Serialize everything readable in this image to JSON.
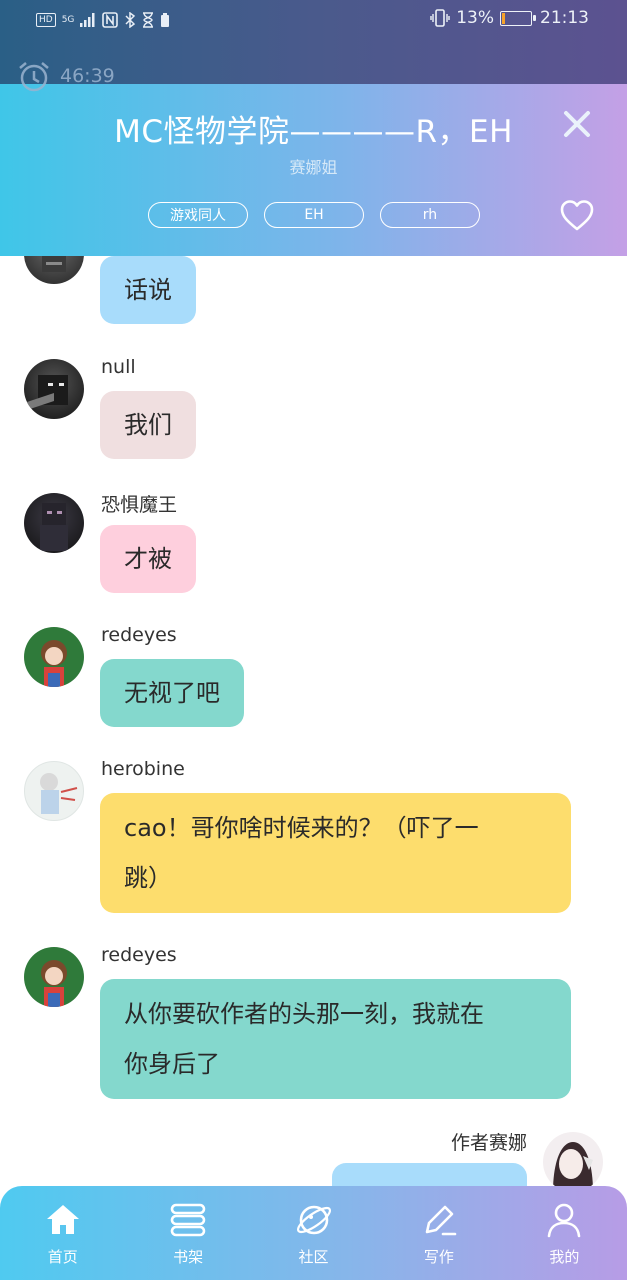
{
  "status_bar": {
    "left_icons": [
      "HD",
      "5G"
    ],
    "battery_percent": "13%",
    "battery_level": 0.13,
    "time": "21:13"
  },
  "timer": {
    "value": "46:39"
  },
  "header": {
    "title": "MC怪物学院————R，EH",
    "author": "赛娜姐",
    "tags": [
      "游戏同人",
      "EH",
      "rh"
    ]
  },
  "messages": [
    {
      "name": "",
      "text": "话说",
      "color": "#a8dcfb",
      "side": "left"
    },
    {
      "name": "null",
      "text": "我们",
      "color": "#f0dfe0",
      "side": "left"
    },
    {
      "name": "恐惧魔王",
      "text": "才被",
      "color": "#fecfdd",
      "side": "left"
    },
    {
      "name": "redeyes",
      "text": "无视了吧",
      "color": "#84d8cd",
      "side": "left"
    },
    {
      "name": "herobine",
      "text_line1": "cao！哥你啥时候来的？（吓了一",
      "text_line2": "跳）",
      "color": "#fddd6d",
      "side": "left"
    },
    {
      "name": "redeyes",
      "text_line1": "从你要砍作者的头那一刻，我就在",
      "text_line2": "你身后了",
      "color": "#84d8cd",
      "side": "left"
    },
    {
      "name": "作者赛娜",
      "text": "",
      "color": "#a8dcfb",
      "side": "right"
    }
  ],
  "nav": [
    {
      "label": "首页",
      "icon": "home-icon"
    },
    {
      "label": "书架",
      "icon": "bookshelf-icon"
    },
    {
      "label": "社区",
      "icon": "planet-icon"
    },
    {
      "label": "写作",
      "icon": "pen-icon"
    },
    {
      "label": "我的",
      "icon": "user-icon"
    }
  ]
}
